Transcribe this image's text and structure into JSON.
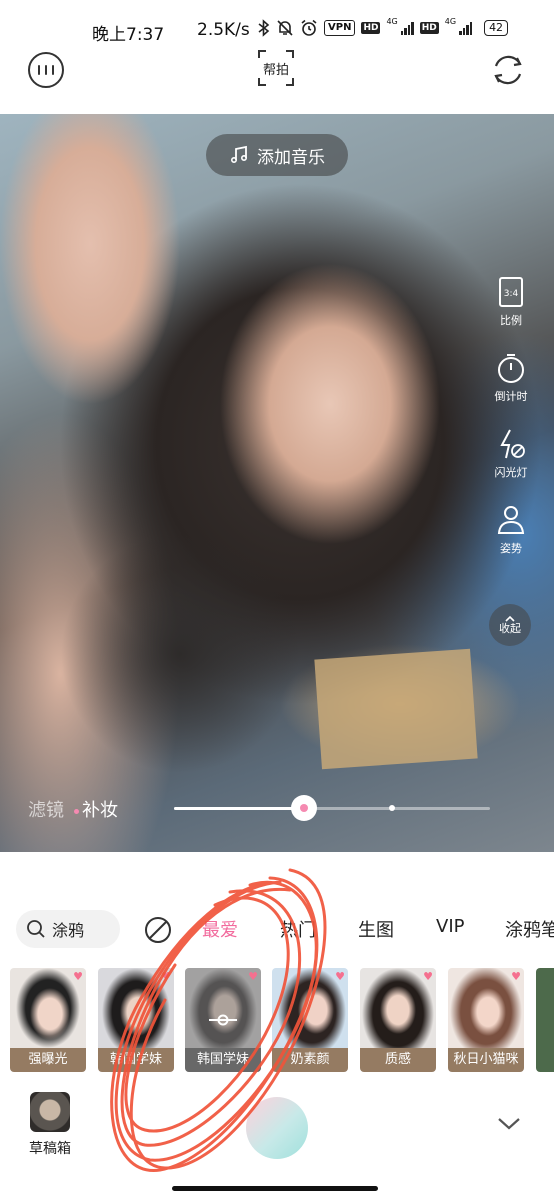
{
  "status_bar": {
    "time": "晚上7:37",
    "net_speed": "2.5K/s",
    "vpn_label": "VPN",
    "hd1": "HD",
    "net1": "4G",
    "hd2": "HD",
    "net2": "4G",
    "battery": "42"
  },
  "toolbar": {
    "help_label": "帮拍"
  },
  "camera": {
    "music_label": "添加音乐",
    "tools": [
      {
        "label": "比例",
        "icon": "ratio-icon",
        "badge": "3:4"
      },
      {
        "label": "倒计时",
        "icon": "timer-icon"
      },
      {
        "label": "闪光灯",
        "icon": "flash-off-icon"
      },
      {
        "label": "姿势",
        "icon": "pose-icon"
      }
    ],
    "collapse_label": "收起",
    "filter_tab": "滤镜",
    "makeup_tab": "补妆",
    "intensity_fraction": 0.41
  },
  "categories": {
    "search_label": "涂鸦",
    "tabs": [
      "最爱",
      "热门",
      "生图",
      "VIP",
      "涂鸦笔"
    ],
    "active_tab": "最爱"
  },
  "filters": [
    {
      "label": "强曝光",
      "selected": false
    },
    {
      "label": "韩国学妹",
      "selected": false
    },
    {
      "label": "韩国学妹",
      "selected": true
    },
    {
      "label": "奶素颜",
      "selected": false
    },
    {
      "label": "质感",
      "selected": false
    },
    {
      "label": "秋日小猫咪",
      "selected": false
    }
  ],
  "bottom": {
    "drafts_label": "草稿箱"
  },
  "colors": {
    "accent_pink": "#f26b9d",
    "scribble_red": "#f0543a"
  }
}
